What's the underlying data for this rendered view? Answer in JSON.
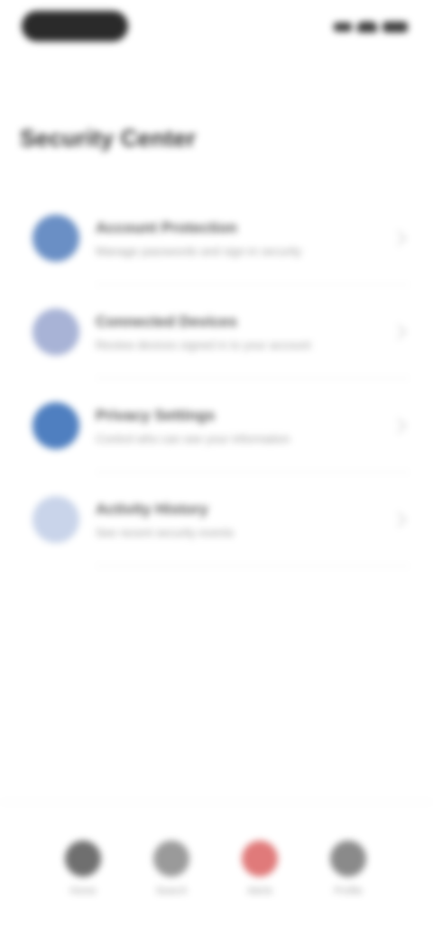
{
  "status_bar": {
    "icons": [
      "signal-icon",
      "wifi-icon",
      "battery-icon"
    ]
  },
  "page": {
    "title": "Security Center"
  },
  "list": {
    "items": [
      {
        "title": "Account Protection",
        "subtitle": "Manage passwords and sign-in security",
        "icon": "shield-icon",
        "color": "#6a8fc5"
      },
      {
        "title": "Connected Devices",
        "subtitle": "Review devices signed in to your account",
        "icon": "devices-icon",
        "color": "#a8b3d6"
      },
      {
        "title": "Privacy Settings",
        "subtitle": "Control who can see your information",
        "icon": "lock-icon",
        "color": "#4f7fc0"
      },
      {
        "title": "Activity History",
        "subtitle": "See recent security events",
        "icon": "history-icon",
        "color": "#c9d4ea"
      }
    ]
  },
  "tabs": [
    {
      "label": "Home",
      "icon": "home-icon",
      "color": "#6f6f6f"
    },
    {
      "label": "Search",
      "icon": "search-icon",
      "color": "#9a9a9a"
    },
    {
      "label": "Alerts",
      "icon": "alert-icon",
      "color": "#e07a7a"
    },
    {
      "label": "Profile",
      "icon": "profile-icon",
      "color": "#8a8a8a"
    }
  ]
}
